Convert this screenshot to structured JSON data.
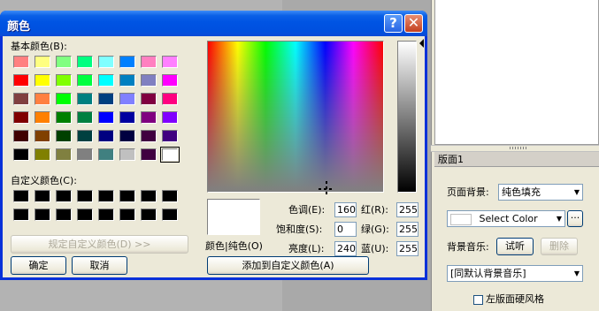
{
  "dialog": {
    "title": "颜色",
    "help_glyph": "?",
    "close_glyph": "✕",
    "basic_colors_label": "基本颜色(B):",
    "custom_colors_label": "自定义颜色(C):",
    "define_custom_button": "规定自定义颜色(D) >>",
    "ok_button": "确定",
    "cancel_button": "取消",
    "color_solid_label": "颜色|纯色(O)",
    "add_custom_button": "添加到自定义颜色(A)",
    "hue_label": "色调(E):",
    "hue_value": "160",
    "sat_label": "饱和度(S):",
    "sat_value": "0",
    "lum_label": "亮度(L):",
    "lum_value": "240",
    "red_label": "红(R):",
    "red_value": "255",
    "green_label": "绿(G):",
    "green_value": "255",
    "blue_label": "蓝(U):",
    "blue_value": "255",
    "basic_colors": [
      "#ff8080",
      "#ffff80",
      "#80ff80",
      "#00ff80",
      "#80ffff",
      "#0080ff",
      "#ff80c0",
      "#ff80ff",
      "#ff0000",
      "#ffff00",
      "#80ff00",
      "#00ff40",
      "#00ffff",
      "#0080c0",
      "#8080c0",
      "#ff00ff",
      "#804040",
      "#ff8040",
      "#00ff00",
      "#008080",
      "#004080",
      "#8080ff",
      "#800040",
      "#ff0080",
      "#800000",
      "#ff8000",
      "#008000",
      "#008040",
      "#0000ff",
      "#0000a0",
      "#800080",
      "#8000ff",
      "#400000",
      "#804000",
      "#004000",
      "#004040",
      "#000080",
      "#000040",
      "#400040",
      "#400080",
      "#000000",
      "#808000",
      "#808040",
      "#808080",
      "#408080",
      "#c0c0c0",
      "#400040",
      "#ffffff"
    ],
    "custom_colors": [
      "#000000",
      "#000000",
      "#000000",
      "#000000",
      "#000000",
      "#000000",
      "#000000",
      "#000000",
      "#000000",
      "#000000",
      "#000000",
      "#000000",
      "#000000",
      "#000000",
      "#000000",
      "#000000"
    ]
  },
  "panel": {
    "header": "版面1",
    "page_bg_label": "页面背景:",
    "page_bg_value": "纯色填充",
    "select_color_value": "Select Color",
    "more_glyph": "···",
    "bg_music_label": "背景音乐:",
    "listen_button": "试听",
    "delete_button": "删除",
    "music_value": "[同默认背景音乐]",
    "left_style_label": "左版面硬风格",
    "dropdown_arrow": "▼"
  }
}
